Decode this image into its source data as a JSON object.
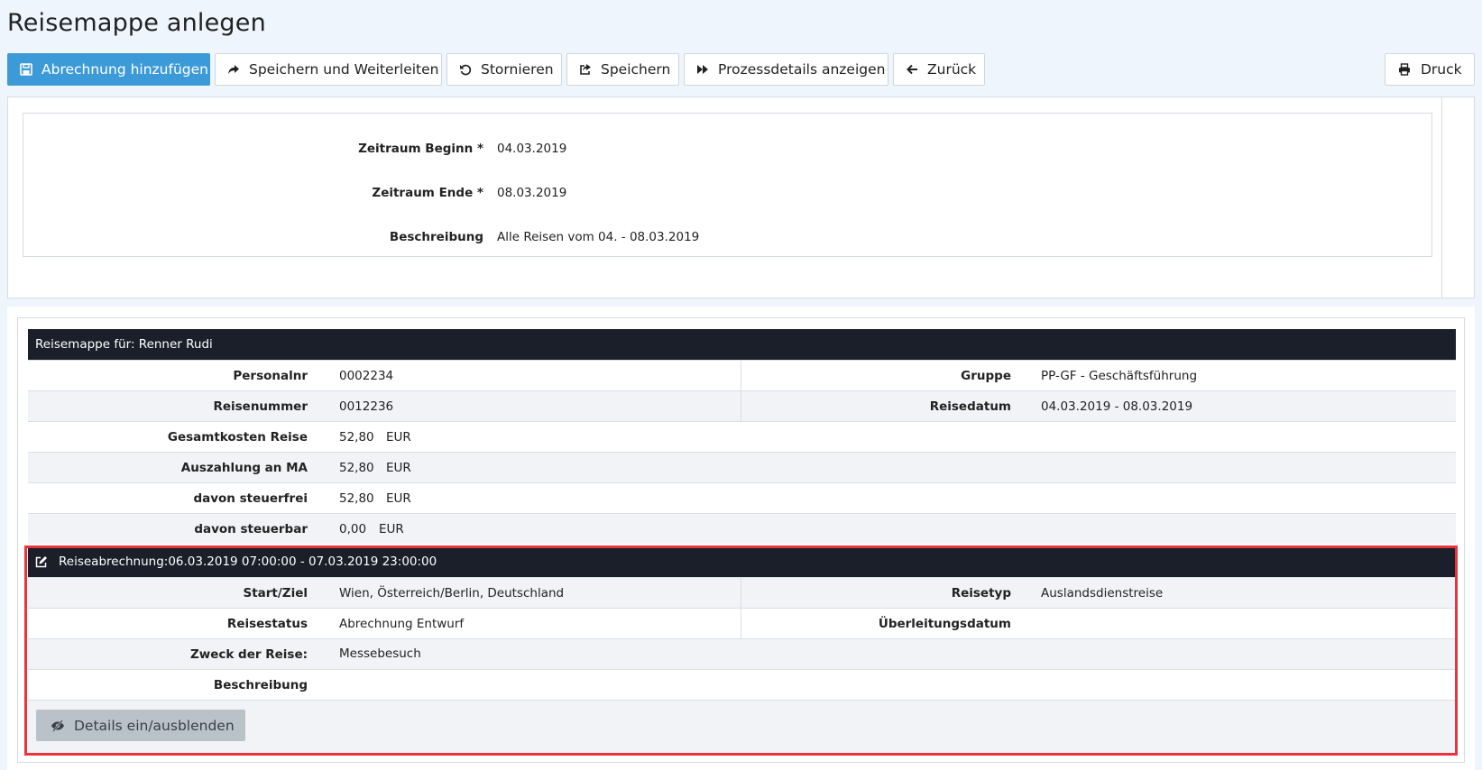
{
  "page": {
    "title": "Reisemappe anlegen"
  },
  "toolbar": {
    "add_invoice": "Abrechnung hinzufügen",
    "save_forward": "Speichern und Weiterleiten",
    "cancel": "Stornieren",
    "save": "Speichern",
    "process_details": "Prozessdetails anzeigen",
    "back": "Zurück",
    "print": "Druck"
  },
  "form": {
    "start_label": "Zeitraum Beginn *",
    "start_value": "04.03.2019",
    "end_label": "Zeitraum Ende *",
    "end_value": "08.03.2019",
    "desc_label": "Beschreibung",
    "desc_value": "Alle Reisen vom 04. - 08.03.2019"
  },
  "folder": {
    "header": "Reisemappe für: Renner Rudi",
    "personalnr_label": "Personalnr",
    "personalnr": "0002234",
    "gruppe_label": "Gruppe",
    "gruppe": "PP-GF - Geschäftsführung",
    "reisenummer_label": "Reisenummer",
    "reisenummer": "0012236",
    "reisedatum_label": "Reisedatum",
    "reisedatum": "04.03.2019 - 08.03.2019",
    "gesamt_label": "Gesamtkosten Reise",
    "gesamt": "52,80",
    "auszahlung_label": "Auszahlung an MA",
    "auszahlung": "52,80",
    "steuerfrei_label": "davon steuerfrei",
    "steuerfrei": "52,80",
    "steuerbar_label": "davon steuerbar",
    "steuerbar": "0,00",
    "currency": "EUR"
  },
  "invoice": {
    "header": "Reiseabrechnung:06.03.2019 07:00:00 - 07.03.2019 23:00:00",
    "start_ziel_label": "Start/Ziel",
    "start_ziel": "Wien, Österreich/Berlin, Deutschland",
    "reisetyp_label": "Reisetyp",
    "reisetyp": "Auslandsdienstreise",
    "reisestatus_label": "Reisestatus",
    "reisestatus": "Abrechnung Entwurf",
    "ueberleitung_label": "Überleitungsdatum",
    "ueberleitung": "",
    "zweck_label": "Zweck der Reise:",
    "zweck": "Messebesuch",
    "beschreibung_label": "Beschreibung",
    "beschreibung": "",
    "toggle_details": "Details ein/ausblenden"
  },
  "colors": {
    "primary": "#3c9ad8",
    "dark_header": "#1b1f2a",
    "highlight": "#e8343d"
  }
}
